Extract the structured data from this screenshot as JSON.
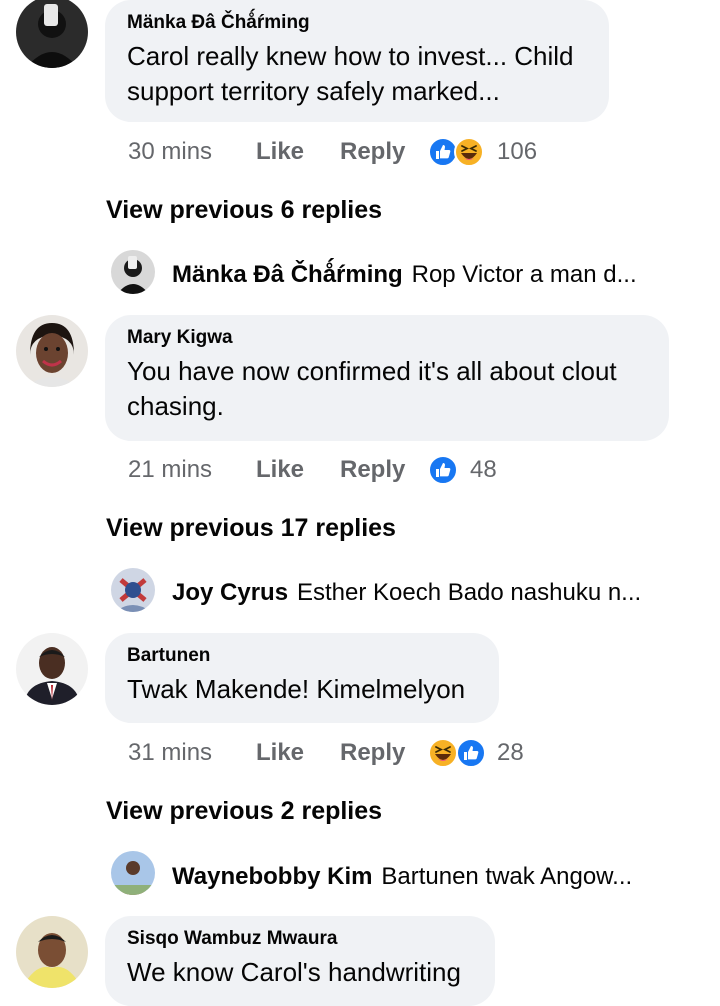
{
  "comments": [
    {
      "author": "Mänka Đâ Čhǻŕming",
      "text": "Carol really knew how to invest... Child support territory safely marked...",
      "time": "30 mins",
      "like_label": "Like",
      "reply_label": "Reply",
      "reactions": [
        "like-icon",
        "haha-icon"
      ],
      "reaction_count": "106",
      "view_previous": "View previous 6 replies",
      "reply": {
        "author": "Mänka Đâ Čhǻŕming",
        "text": "Rop Victor a man d..."
      }
    },
    {
      "author": "Mary Kigwa",
      "text": "You have now confirmed  it's all about clout chasing.",
      "time": "21 mins",
      "like_label": "Like",
      "reply_label": "Reply",
      "reactions": [
        "like-icon"
      ],
      "reaction_count": "48",
      "view_previous": "View previous 17 replies",
      "reply": {
        "author": "Joy Cyrus",
        "text": "Esther Koech Bado nashuku n..."
      }
    },
    {
      "author": "Bartunen",
      "text": "Twak Makende! Kimelmelyon",
      "time": "31 mins",
      "like_label": "Like",
      "reply_label": "Reply",
      "reactions": [
        "haha-icon",
        "like-icon"
      ],
      "reaction_count": "28",
      "view_previous": "View previous 2 replies",
      "reply": {
        "author": "Waynebobby Kim",
        "text": "Bartunen twak Angow..."
      }
    },
    {
      "author": "Sisqo Wambuz Mwaura",
      "text": "We know Carol's handwriting"
    }
  ],
  "colors": {
    "bubble": "#f0f2f5",
    "meta_text": "#65676b",
    "like_blue": "#1877f2",
    "haha_yellow": "#f7b125"
  }
}
